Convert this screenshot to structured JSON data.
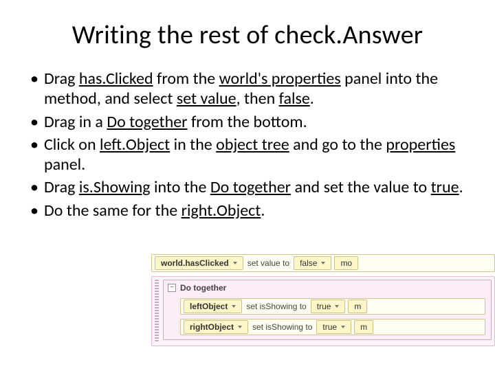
{
  "title": "Writing the rest of check.Answer",
  "bullets": [
    {
      "parts": [
        {
          "t": "Drag "
        },
        {
          "t": "has.Clicked",
          "u": true
        },
        {
          "t": " from the "
        },
        {
          "t": "world's properties",
          "u": true
        },
        {
          "t": " panel into the method, and select "
        },
        {
          "t": "set value",
          "u": true
        },
        {
          "t": ", then "
        },
        {
          "t": "false",
          "u": true
        },
        {
          "t": "."
        }
      ]
    },
    {
      "parts": [
        {
          "t": "Drag in a "
        },
        {
          "t": "Do together",
          "u": true
        },
        {
          "t": " from the bottom."
        }
      ]
    },
    {
      "parts": [
        {
          "t": "Click on "
        },
        {
          "t": "left.Object",
          "u": true
        },
        {
          "t": " in the "
        },
        {
          "t": "object tree",
          "u": true
        },
        {
          "t": " and go to the "
        },
        {
          "t": "properties",
          "u": true
        },
        {
          "t": " panel."
        }
      ]
    },
    {
      "parts": [
        {
          "t": "Drag "
        },
        {
          "t": "is.Showing",
          "u": true
        },
        {
          "t": " into the "
        },
        {
          "t": "Do together",
          "u": true
        },
        {
          "t": " and set the value to "
        },
        {
          "t": "true",
          "u": true
        },
        {
          "t": "."
        }
      ]
    },
    {
      "parts": [
        {
          "t": " Do the same for the "
        },
        {
          "t": "right.Object",
          "u": true
        },
        {
          "t": "."
        }
      ]
    }
  ],
  "alice": {
    "row1": {
      "var": "world.hasClicked",
      "label": "set value to",
      "value": "false",
      "more": "mo"
    },
    "doTogether": {
      "header": "Do together",
      "rows": [
        {
          "obj": "leftObject",
          "prop": "set isShowing to",
          "val": "true",
          "more": "m"
        },
        {
          "obj": "rightObject",
          "prop": "set isShowing to",
          "val": "true",
          "more": "m"
        }
      ]
    }
  }
}
